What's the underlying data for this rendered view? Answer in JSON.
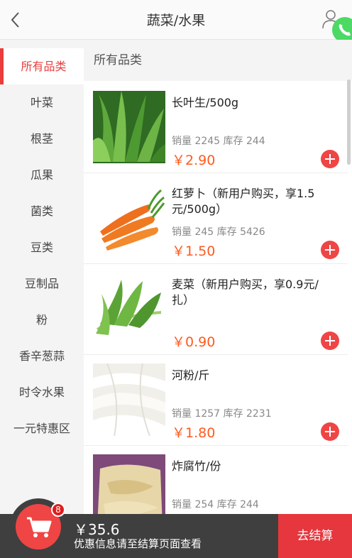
{
  "header": {
    "title": "蔬菜/水果"
  },
  "sidebar": {
    "items": [
      {
        "label": "所有品类",
        "active": true
      },
      {
        "label": "叶菜"
      },
      {
        "label": "根茎"
      },
      {
        "label": "瓜果"
      },
      {
        "label": "菌类"
      },
      {
        "label": "豆类"
      },
      {
        "label": "豆制品"
      },
      {
        "label": "粉"
      },
      {
        "label": "香辛葱蒜"
      },
      {
        "label": "时令水果"
      },
      {
        "label": "一元特惠区"
      }
    ]
  },
  "content": {
    "section_title": "所有品类",
    "products": [
      {
        "name": "长叶生/500g",
        "stats": "销量 2245 库存 244",
        "price": "￥2.90",
        "image": "lettuce-image"
      },
      {
        "name": "红萝卜（新用户购买，享1.5元/500g）",
        "stats": "销量 245 库存 5426",
        "price": "￥1.50",
        "image": "carrot-image"
      },
      {
        "name": "麦菜（新用户购买，享0.9元/扎）",
        "stats": "",
        "price": "￥0.90",
        "image": "greens-image"
      },
      {
        "name": "河粉/斤",
        "stats": "销量 1257 库存 2231",
        "price": "￥1.80",
        "image": "rice-noodle-image"
      },
      {
        "name": "炸腐竹/份",
        "stats": "销量 254 库存 244",
        "price": "",
        "image": "tofu-skin-image"
      }
    ]
  },
  "footer": {
    "cart_count": "8",
    "total": "￥35.6",
    "promo": "优惠信息请至结算页面查看",
    "checkout_label": "去结算"
  },
  "colors": {
    "accent": "#ea3d3d",
    "price": "#ff5a1f",
    "phone": "#4cd964",
    "footer": "#3f3f3f"
  }
}
